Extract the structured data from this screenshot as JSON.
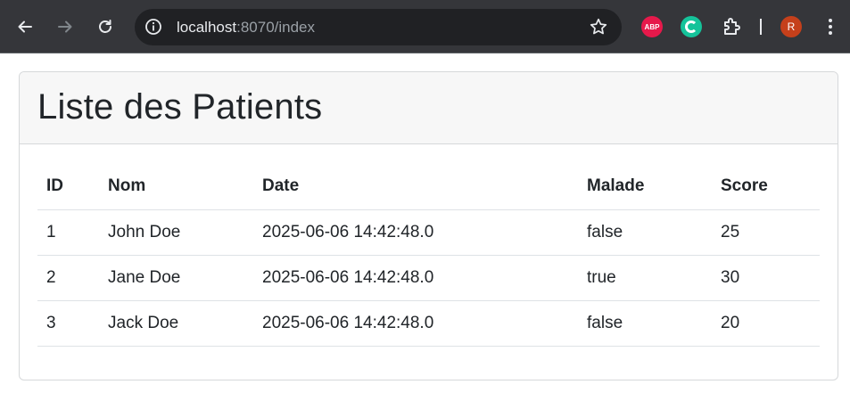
{
  "browser": {
    "url_host": "localhost",
    "url_rest": ":8070/index",
    "ext_abp": "ABP",
    "avatar_letter": "R"
  },
  "page": {
    "title": "Liste des Patients",
    "columns": [
      "ID",
      "Nom",
      "Date",
      "Malade",
      "Score"
    ],
    "rows": [
      {
        "id": "1",
        "nom": "John Doe",
        "date": "2025-06-06 14:42:48.0",
        "malade": "false",
        "score": "25"
      },
      {
        "id": "2",
        "nom": "Jane Doe",
        "date": "2025-06-06 14:42:48.0",
        "malade": "true",
        "score": "30"
      },
      {
        "id": "3",
        "nom": "Jack Doe",
        "date": "2025-06-06 14:42:48.0",
        "malade": "false",
        "score": "20"
      }
    ]
  }
}
